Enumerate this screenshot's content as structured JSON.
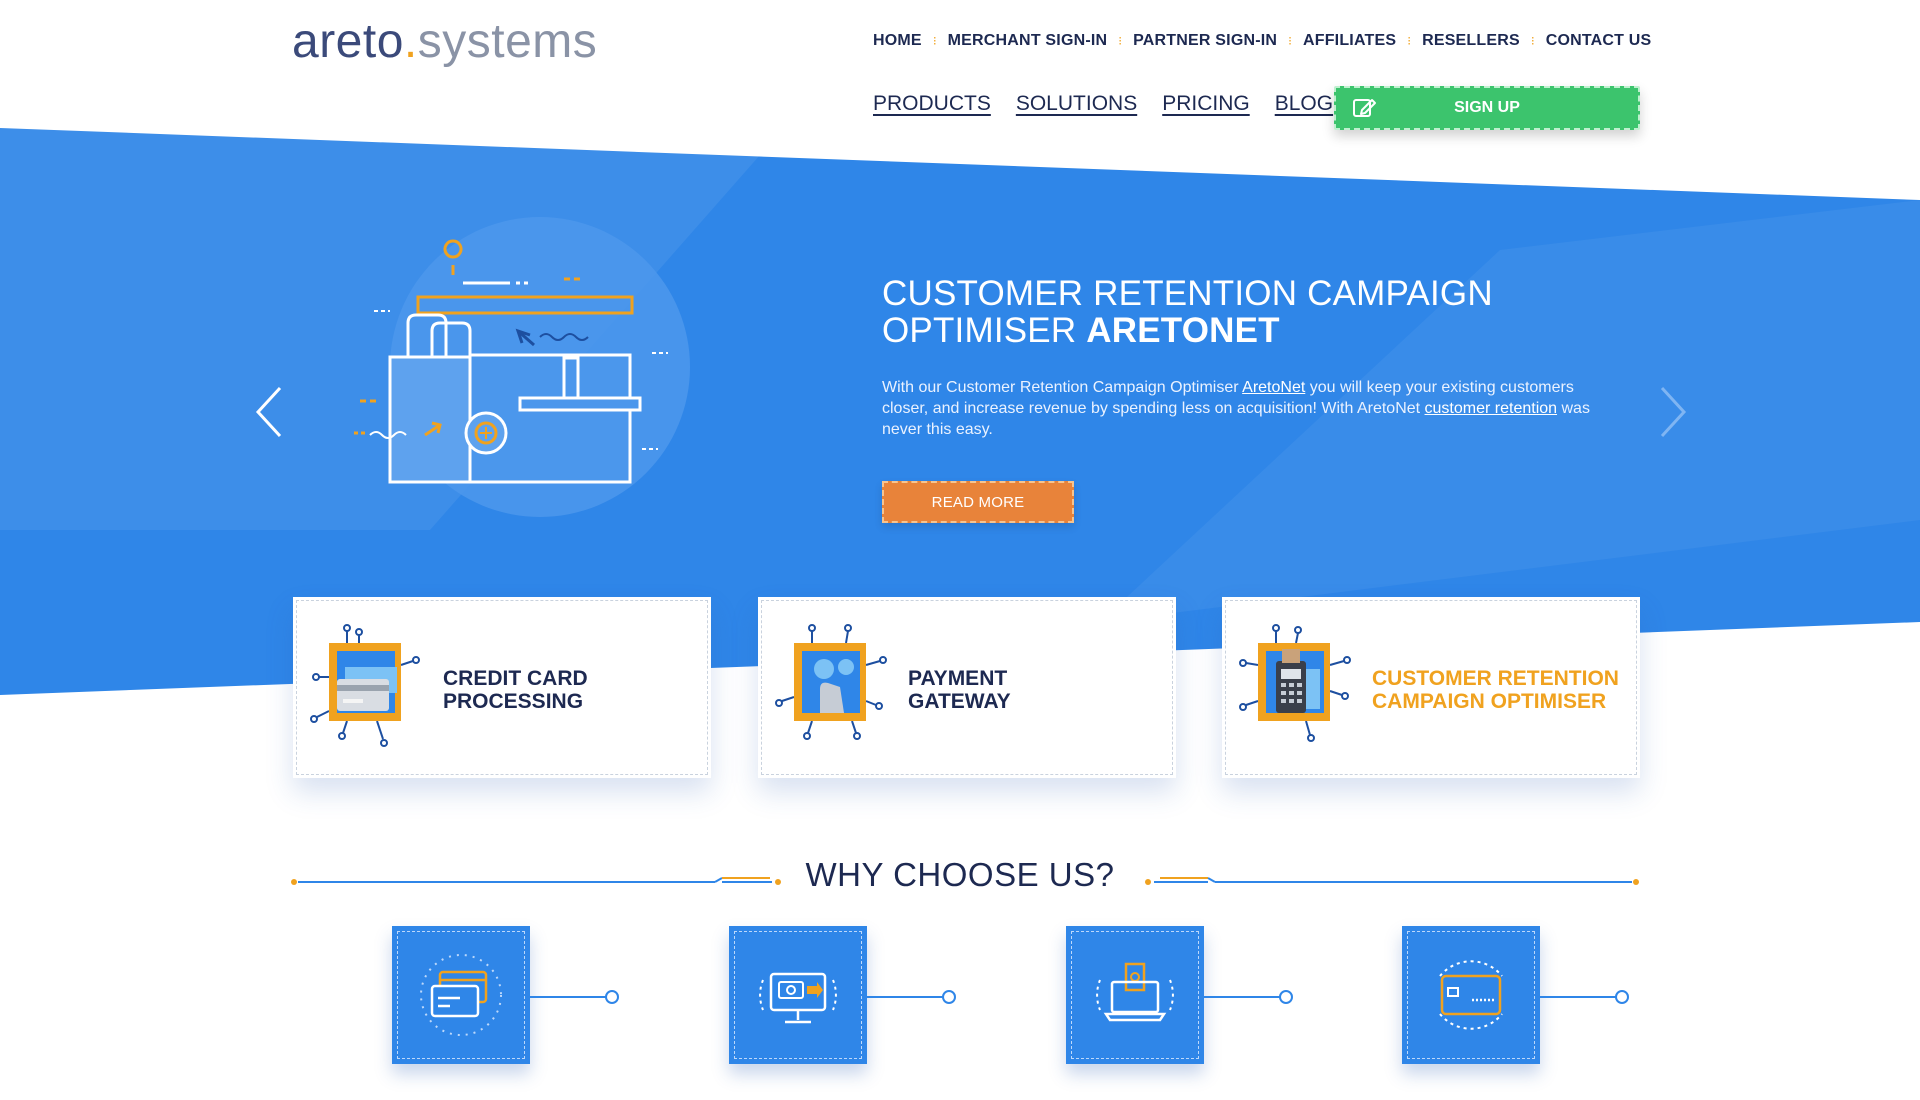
{
  "header": {
    "logo": {
      "part1": "areto",
      "dot": ".",
      "part2": "systems"
    },
    "top_nav": [
      "HOME",
      "MERCHANT SIGN-IN",
      "PARTNER SIGN-IN",
      "AFFILIATES",
      "RESELLERS",
      "CONTACT US"
    ],
    "main_nav": [
      "PRODUCTS",
      "SOLUTIONS",
      "PRICING",
      "BLOG"
    ],
    "signup_label": "SIGN UP"
  },
  "hero": {
    "title_line1": "CUSTOMER RETENTION CAMPAIGN",
    "title_line2_regular": "OPTIMISER",
    "title_line2_bold": "ARETONET",
    "text_part1": "With our Customer Retention Campaign Optimiser ",
    "text_link1": "AretoNet",
    "text_part2": " you will keep your existing customers closer, and increase revenue by spending less on acquisition! With AretoNet ",
    "text_link2": "customer retention",
    "text_part3": " was never this easy.",
    "read_more_label": "READ MORE"
  },
  "cards": [
    {
      "line1": "CREDIT CARD",
      "line2": "PROCESSING"
    },
    {
      "line1": "PAYMENT",
      "line2": "GATEWAY"
    },
    {
      "line1": "CUSTOMER RETENTION",
      "line2": "CAMPAIGN OPTIMISER"
    }
  ],
  "why": {
    "title": "WHY CHOOSE US?"
  },
  "colors": {
    "primary_blue": "#2f86e8",
    "dark_navy": "#1d2951",
    "accent_orange": "#f0a21f",
    "signup_green": "#3cc46d",
    "read_more_orange": "#e8833a"
  },
  "icons": {
    "signup": "edit-icon",
    "arrows": [
      "chevron-left-icon",
      "chevron-right-icon"
    ],
    "cards": [
      "credit-card-chip-icon",
      "payment-gateway-chip-icon",
      "pos-terminal-chip-icon"
    ],
    "features": [
      "cards-icon",
      "monitor-cash-icon",
      "laptop-money-icon",
      "bank-card-icon"
    ]
  }
}
